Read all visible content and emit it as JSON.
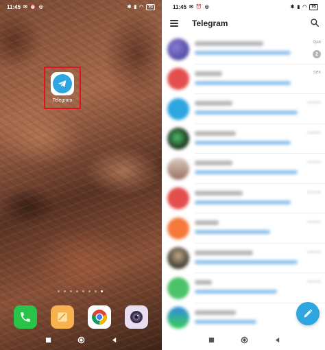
{
  "home": {
    "status": {
      "time": "11:45",
      "battery": "95"
    },
    "shortcut": {
      "label": "Telegram"
    },
    "page_indicators": 8,
    "dock": [
      {
        "app": "phone-icon"
      },
      {
        "app": "notes-icon"
      },
      {
        "app": "chrome-icon"
      },
      {
        "app": "camera-icon"
      }
    ]
  },
  "telegram": {
    "status": {
      "time": "11:45",
      "battery": "95"
    },
    "appbar": {
      "title": "Telegram"
    },
    "chats": [
      {
        "time": "qua",
        "unread": "2"
      },
      {
        "time": "sex"
      }
    ],
    "accent": "#2ea6e0"
  },
  "colors": {
    "highlight_box": "#e0131c",
    "telegram_blue": "#2ea6e0"
  }
}
